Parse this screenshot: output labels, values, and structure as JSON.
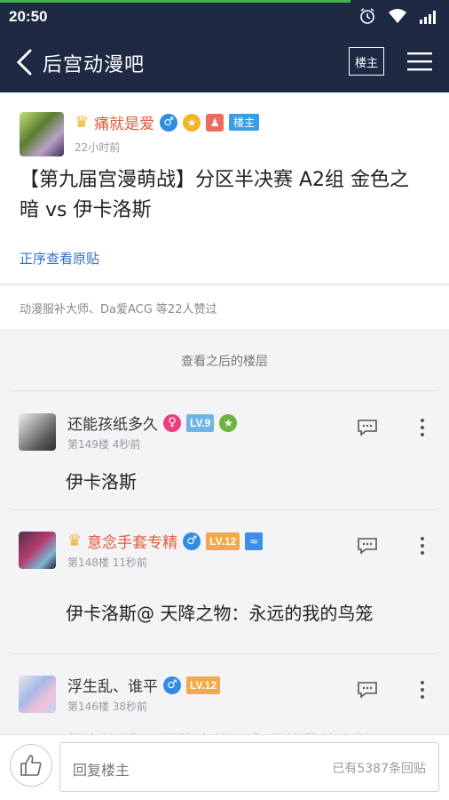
{
  "status_bar": {
    "time": "20:50",
    "progress_fraction": 0.78,
    "icons": [
      "alarm-icon",
      "wifi-icon",
      "signal-icon"
    ]
  },
  "app_bar": {
    "title": "后宫动漫吧",
    "op_filter_label": "楼主",
    "icons": [
      "back-arrow-icon",
      "menu-icon"
    ]
  },
  "op_post": {
    "author": "痛就是爱",
    "gender_symbol": "♂",
    "op_badge": "楼主",
    "time": "22小时前",
    "title": "【第九届宫漫萌战】分区半决赛 A2组 金色之暗 vs 伊卡洛斯",
    "source_link": "正序查看原贴"
  },
  "likes": {
    "text": "动漫服补大师、Da爱ACG 等22人赞过"
  },
  "section": {
    "label": "查看之后的楼层"
  },
  "replies": [
    {
      "author": "还能孩纸多久",
      "gender_symbol": "♀",
      "level": "LV.9",
      "floor": "第149楼",
      "time": "4秒前",
      "content": "伊卡洛斯"
    },
    {
      "author": "意念手套专精",
      "gender_symbol": "♂",
      "level": "LV.12",
      "floor": "第148楼",
      "time": "11秒前",
      "content": "伊卡洛斯@ 天降之物：永远的我的鸟笼"
    },
    {
      "author": "浮生乱、谁平",
      "gender_symbol": "♂",
      "level": "LV.12",
      "floor": "第146楼",
      "time": "38秒前",
      "content": "伊卡洛斯@ 天降之物：永远的我的鸟笼"
    }
  ],
  "bottom_bar": {
    "reply_placeholder": "回复楼主",
    "reply_count": "已有5387条回贴"
  },
  "colors": {
    "header": "#1e2a44",
    "accent_blue": "#3c9ce6",
    "name_red": "#e25a3a",
    "link_blue": "#2f6fc9"
  }
}
